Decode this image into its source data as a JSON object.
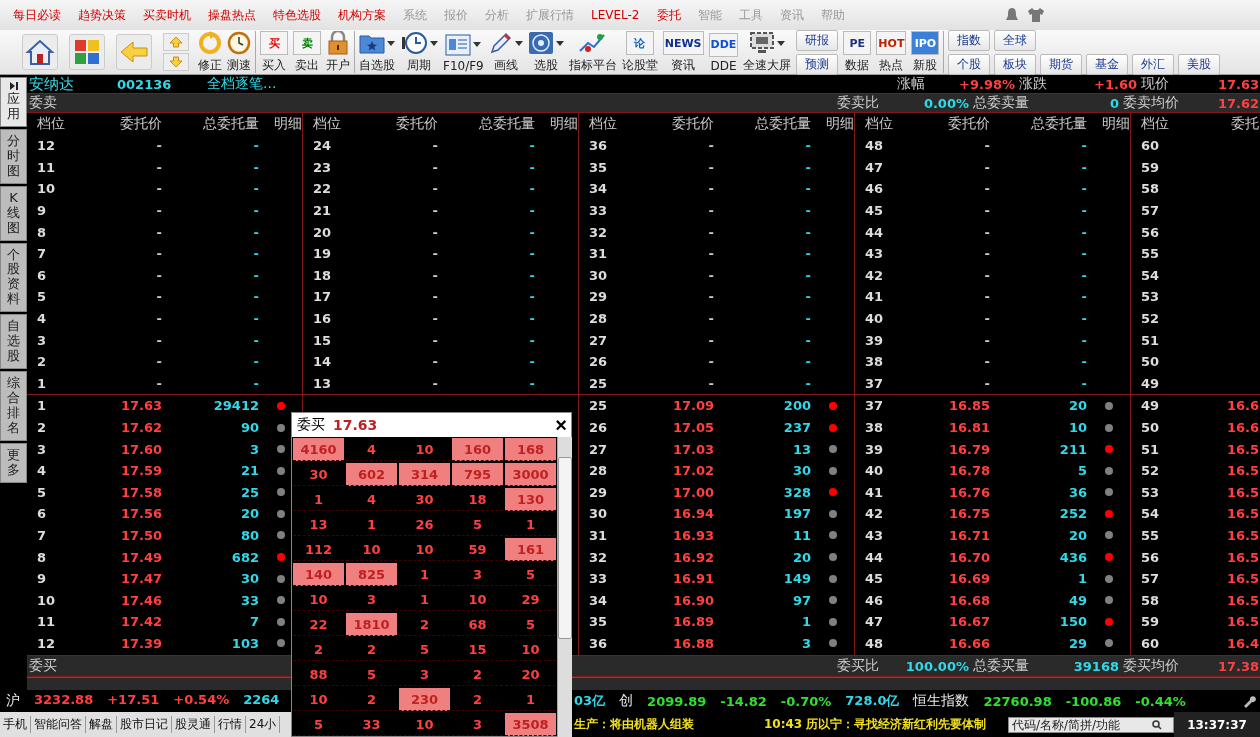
{
  "menu": [
    {
      "label": "每日必读",
      "emphasized": true
    },
    {
      "label": "趋势决策",
      "emphasized": true
    },
    {
      "label": "买卖时机",
      "emphasized": true
    },
    {
      "label": "操盘热点",
      "emphasized": true
    },
    {
      "label": "特色选股",
      "emphasized": true
    },
    {
      "label": "机构方案",
      "emphasized": true
    },
    {
      "label": "系统",
      "emphasized": false
    },
    {
      "label": "报价",
      "emphasized": false
    },
    {
      "label": "分析",
      "emphasized": false
    },
    {
      "label": "扩展行情",
      "emphasized": false
    },
    {
      "label": "LEVEL-2",
      "emphasized": true
    },
    {
      "label": "委托",
      "emphasized": true
    },
    {
      "label": "智能",
      "emphasized": false
    },
    {
      "label": "工具",
      "emphasized": false
    },
    {
      "label": "资讯",
      "emphasized": false
    },
    {
      "label": "帮助",
      "emphasized": false
    }
  ],
  "toolbar": [
    [
      {
        "kind": "big"
      },
      {
        "kind": "big"
      },
      {
        "kind": "big"
      },
      {
        "kind": "updown"
      },
      {
        "kind": "labeled",
        "label": "修正"
      },
      {
        "kind": "labeled",
        "label": "测速"
      }
    ],
    [
      {
        "kind": "labeled",
        "glyph": "买",
        "color": "#e00000",
        "label": "买入"
      },
      {
        "kind": "labeled",
        "glyph": "卖",
        "color": "#008000",
        "label": "卖出"
      },
      {
        "kind": "labeled",
        "label": "开户"
      }
    ],
    [
      {
        "kind": "dropdown",
        "label": "自选股"
      },
      {
        "kind": "dropdown",
        "label": "周期"
      },
      {
        "kind": "dropdown",
        "label": "F10/F9"
      },
      {
        "kind": "dropdown",
        "label": "画线"
      },
      {
        "kind": "dropdown",
        "label": "选股"
      },
      {
        "kind": "labeled",
        "label": "指标平台"
      },
      {
        "kind": "labeled",
        "glyph": "论",
        "color": "#1060c0",
        "label": "论股堂"
      },
      {
        "kind": "labeled",
        "glyph": "NEWS",
        "color": "#103090",
        "label": "资讯"
      },
      {
        "kind": "labeled",
        "glyph": "DDE",
        "color": "#1050d0",
        "label": "DDE"
      },
      {
        "kind": "dropdown",
        "label": "全速大屏"
      },
      {
        "kind": "stack",
        "labels": [
          "研报",
          "预测"
        ]
      },
      {
        "kind": "labeled",
        "glyph": "PE",
        "color": "#203080",
        "label": "数据"
      },
      {
        "kind": "labeled",
        "glyph": "HOT",
        "color": "#c02000",
        "label": "热点"
      },
      {
        "kind": "labeled",
        "glyph": "IPO",
        "label": "新股"
      }
    ],
    [
      {
        "kind": "grid",
        "rows": [
          [
            "指数",
            "全球"
          ],
          [
            "个股",
            "板块",
            "期货",
            "基金",
            "外汇",
            "美股"
          ]
        ]
      }
    ]
  ],
  "side_tabs": [
    {
      "label": "应用",
      "selected": true
    },
    {
      "label": "分时图",
      "selected": false
    },
    {
      "label": "K线图",
      "selected": false
    },
    {
      "label": "个股资料",
      "selected": false
    },
    {
      "label": "自选股",
      "selected": false
    },
    {
      "label": "综合排名",
      "selected": false
    },
    {
      "label": "更多",
      "selected": false
    }
  ],
  "stock": {
    "name": "安纳达",
    "code": "002136",
    "mode": "全档逐笔...",
    "stats": [
      {
        "label": "涨幅",
        "value": "+9.98%"
      },
      {
        "label": "涨跌",
        "value": "+1.60"
      },
      {
        "label": "现价",
        "value": "17.63"
      }
    ]
  },
  "sell_bar": {
    "title": "委卖",
    "stats": [
      {
        "label": "委卖比",
        "value": "0.00%",
        "kind": "amount"
      },
      {
        "label": "总委卖量",
        "value": "0",
        "kind": "amount"
      },
      {
        "label": "委卖均价",
        "value": "17.62",
        "kind": "price"
      }
    ]
  },
  "buy_bar": {
    "title": "委买",
    "stats": [
      {
        "label": "委买比",
        "value": "100.00%",
        "kind": "amount"
      },
      {
        "label": "总委买量",
        "value": "39168",
        "kind": "amount"
      },
      {
        "label": "委买均价",
        "value": "17.38",
        "kind": "price"
      }
    ]
  },
  "groups": [
    {
      "columns": [
        "档位",
        "委托价",
        "总委托量",
        "明细"
      ],
      "sell": [
        [
          "12",
          "-",
          "-"
        ],
        [
          "11",
          "-",
          "-"
        ],
        [
          "10",
          "-",
          "-"
        ],
        [
          "9",
          "-",
          "-"
        ],
        [
          "8",
          "-",
          "-"
        ],
        [
          "7",
          "-",
          "-"
        ],
        [
          "6",
          "-",
          "-"
        ],
        [
          "5",
          "-",
          "-"
        ],
        [
          "4",
          "-",
          "-"
        ],
        [
          "3",
          "-",
          "-"
        ],
        [
          "2",
          "-",
          "-"
        ],
        [
          "1",
          "-",
          "-"
        ]
      ],
      "buy": [
        {
          "level": "1",
          "price": "17.63",
          "volume": "29412",
          "color": "#ff0000"
        },
        {
          "level": "2",
          "price": "17.62",
          "volume": "90",
          "color": "#808080"
        },
        {
          "level": "3",
          "price": "17.60",
          "volume": "3",
          "color": "#808080"
        },
        {
          "level": "4",
          "price": "17.59",
          "volume": "21",
          "color": "#808080"
        },
        {
          "level": "5",
          "price": "17.58",
          "volume": "25",
          "color": "#808080"
        },
        {
          "level": "6",
          "price": "17.56",
          "volume": "20",
          "color": "#808080"
        },
        {
          "level": "7",
          "price": "17.50",
          "volume": "80",
          "color": "#808080"
        },
        {
          "level": "8",
          "price": "17.49",
          "volume": "682",
          "color": "#ff0000"
        },
        {
          "level": "9",
          "price": "17.47",
          "volume": "30",
          "color": "#808080"
        },
        {
          "level": "10",
          "price": "17.46",
          "volume": "33",
          "color": "#808080"
        },
        {
          "level": "11",
          "price": "17.42",
          "volume": "7",
          "color": "#808080"
        },
        {
          "level": "12",
          "price": "17.39",
          "volume": "103",
          "color": "#808080"
        }
      ]
    },
    {
      "columns": [
        "档位",
        "委托价",
        "总委托量",
        "明细"
      ],
      "sell": [
        [
          "24",
          "-",
          "-"
        ],
        [
          "23",
          "-",
          "-"
        ],
        [
          "22",
          "-",
          "-"
        ],
        [
          "21",
          "-",
          "-"
        ],
        [
          "20",
          "-",
          "-"
        ],
        [
          "19",
          "-",
          "-"
        ],
        [
          "18",
          "-",
          "-"
        ],
        [
          "17",
          "-",
          "-"
        ],
        [
          "16",
          "-",
          "-"
        ],
        [
          "15",
          "-",
          "-"
        ],
        [
          "14",
          "-",
          "-"
        ],
        [
          "13",
          "-",
          "-"
        ]
      ]
    },
    {
      "columns": [
        "档位",
        "委托价",
        "总委托量",
        "明细"
      ],
      "sell": [
        [
          "36",
          "-",
          "-"
        ],
        [
          "35",
          "-",
          "-"
        ],
        [
          "34",
          "-",
          "-"
        ],
        [
          "33",
          "-",
          "-"
        ],
        [
          "32",
          "-",
          "-"
        ],
        [
          "31",
          "-",
          "-"
        ],
        [
          "30",
          "-",
          "-"
        ],
        [
          "29",
          "-",
          "-"
        ],
        [
          "28",
          "-",
          "-"
        ],
        [
          "27",
          "-",
          "-"
        ],
        [
          "26",
          "-",
          "-"
        ],
        [
          "25",
          "-",
          "-"
        ]
      ],
      "buy": [
        {
          "level": "25",
          "price": "17.09",
          "volume": "200",
          "color": "#ff0000"
        },
        {
          "level": "26",
          "price": "17.05",
          "volume": "237",
          "color": "#ff0000"
        },
        {
          "level": "27",
          "price": "17.03",
          "volume": "13",
          "color": "#808080"
        },
        {
          "level": "28",
          "price": "17.02",
          "volume": "30",
          "color": "#808080"
        },
        {
          "level": "29",
          "price": "17.00",
          "volume": "328",
          "color": "#ff0000"
        },
        {
          "level": "30",
          "price": "16.94",
          "volume": "197",
          "color": "#808080"
        },
        {
          "level": "31",
          "price": "16.93",
          "volume": "11",
          "color": "#808080"
        },
        {
          "level": "32",
          "price": "16.92",
          "volume": "20",
          "color": "#808080"
        },
        {
          "level": "33",
          "price": "16.91",
          "volume": "149",
          "color": "#808080"
        },
        {
          "level": "34",
          "price": "16.90",
          "volume": "97",
          "color": "#808080"
        },
        {
          "level": "35",
          "price": "16.89",
          "volume": "1",
          "color": "#808080"
        },
        {
          "level": "36",
          "price": "16.88",
          "volume": "3",
          "color": "#808080"
        }
      ]
    },
    {
      "columns": [
        "档位",
        "委托价",
        "总委托量",
        "明细"
      ],
      "sell": [
        [
          "48",
          "-",
          "-"
        ],
        [
          "47",
          "-",
          "-"
        ],
        [
          "46",
          "-",
          "-"
        ],
        [
          "45",
          "-",
          "-"
        ],
        [
          "44",
          "-",
          "-"
        ],
        [
          "43",
          "-",
          "-"
        ],
        [
          "42",
          "-",
          "-"
        ],
        [
          "41",
          "-",
          "-"
        ],
        [
          "40",
          "-",
          "-"
        ],
        [
          "39",
          "-",
          "-"
        ],
        [
          "38",
          "-",
          "-"
        ],
        [
          "37",
          "-",
          "-"
        ]
      ],
      "buy": [
        {
          "level": "37",
          "price": "16.85",
          "volume": "20",
          "color": "#808080"
        },
        {
          "level": "38",
          "price": "16.81",
          "volume": "10",
          "color": "#808080"
        },
        {
          "level": "39",
          "price": "16.79",
          "volume": "211",
          "color": "#ff0000"
        },
        {
          "level": "40",
          "price": "16.78",
          "volume": "5",
          "color": "#808080"
        },
        {
          "level": "41",
          "price": "16.76",
          "volume": "36",
          "color": "#808080"
        },
        {
          "level": "42",
          "price": "16.75",
          "volume": "252",
          "color": "#ff0000"
        },
        {
          "level": "43",
          "price": "16.71",
          "volume": "20",
          "color": "#808080"
        },
        {
          "level": "44",
          "price": "16.70",
          "volume": "436",
          "color": "#ff0000"
        },
        {
          "level": "45",
          "price": "16.69",
          "volume": "1",
          "color": "#808080"
        },
        {
          "level": "46",
          "price": "16.68",
          "volume": "49",
          "color": "#808080"
        },
        {
          "level": "47",
          "price": "16.67",
          "volume": "150",
          "color": "#ff0000"
        },
        {
          "level": "48",
          "price": "16.66",
          "volume": "29",
          "color": "#808080"
        }
      ]
    },
    {
      "columns": [
        "档位",
        "委托"
      ],
      "sell": [
        [
          "60"
        ],
        [
          "59"
        ],
        [
          "58"
        ],
        [
          "57"
        ],
        [
          "56"
        ],
        [
          "55"
        ],
        [
          "54"
        ],
        [
          "53"
        ],
        [
          "52"
        ],
        [
          "51"
        ],
        [
          "50"
        ],
        [
          "49"
        ]
      ],
      "buy": [
        {
          "level": "49",
          "price": "16.6"
        },
        {
          "level": "50",
          "price": "16.6"
        },
        {
          "level": "51",
          "price": "16.5"
        },
        {
          "level": "52",
          "price": "16.5"
        },
        {
          "level": "53",
          "price": "16.5"
        },
        {
          "level": "54",
          "price": "16.5"
        },
        {
          "level": "55",
          "price": "16.5"
        },
        {
          "level": "56",
          "price": "16.5"
        },
        {
          "level": "57",
          "price": "16.5"
        },
        {
          "level": "58",
          "price": "16.5"
        },
        {
          "level": "59",
          "price": "16.5"
        },
        {
          "level": "60",
          "price": "16.4"
        }
      ]
    }
  ],
  "popup": {
    "title": "委买",
    "price": "17.63",
    "close": "×",
    "cells": [
      [
        {
          "v": "4160",
          "highlighted": true
        },
        {
          "v": "4",
          "highlighted": false
        },
        {
          "v": "10",
          "highlighted": false
        },
        {
          "v": "160",
          "highlighted": true
        },
        {
          "v": "168",
          "highlighted": true
        }
      ],
      [
        {
          "v": "30",
          "highlighted": false
        },
        {
          "v": "602",
          "highlighted": true
        },
        {
          "v": "314",
          "highlighted": true
        },
        {
          "v": "795",
          "highlighted": true
        },
        {
          "v": "3000",
          "highlighted": true
        }
      ],
      [
        {
          "v": "1",
          "highlighted": false
        },
        {
          "v": "4",
          "highlighted": false
        },
        {
          "v": "30",
          "highlighted": false
        },
        {
          "v": "18",
          "highlighted": false
        },
        {
          "v": "130",
          "highlighted": true
        }
      ],
      [
        {
          "v": "13",
          "highlighted": false
        },
        {
          "v": "1",
          "highlighted": false
        },
        {
          "v": "26",
          "highlighted": false
        },
        {
          "v": "5",
          "highlighted": false
        },
        {
          "v": "1",
          "highlighted": false
        }
      ],
      [
        {
          "v": "112",
          "highlighted": false
        },
        {
          "v": "10",
          "highlighted": false
        },
        {
          "v": "10",
          "highlighted": false
        },
        {
          "v": "59",
          "highlighted": false
        },
        {
          "v": "161",
          "highlighted": true
        }
      ],
      [
        {
          "v": "140",
          "highlighted": true
        },
        {
          "v": "825",
          "highlighted": true
        },
        {
          "v": "1",
          "highlighted": false
        },
        {
          "v": "3",
          "highlighted": false
        },
        {
          "v": "5",
          "highlighted": false
        }
      ],
      [
        {
          "v": "10",
          "highlighted": false
        },
        {
          "v": "3",
          "highlighted": false
        },
        {
          "v": "1",
          "highlighted": false
        },
        {
          "v": "10",
          "highlighted": false
        },
        {
          "v": "29",
          "highlighted": false
        }
      ],
      [
        {
          "v": "22",
          "highlighted": false
        },
        {
          "v": "1810",
          "highlighted": true
        },
        {
          "v": "2",
          "highlighted": false
        },
        {
          "v": "68",
          "highlighted": false
        },
        {
          "v": "5",
          "highlighted": false
        }
      ],
      [
        {
          "v": "2",
          "highlighted": false
        },
        {
          "v": "2",
          "highlighted": false
        },
        {
          "v": "5",
          "highlighted": false
        },
        {
          "v": "15",
          "highlighted": false
        },
        {
          "v": "10",
          "highlighted": false
        }
      ],
      [
        {
          "v": "88",
          "highlighted": false
        },
        {
          "v": "5",
          "highlighted": false
        },
        {
          "v": "3",
          "highlighted": false
        },
        {
          "v": "2",
          "highlighted": false
        },
        {
          "v": "20",
          "highlighted": false
        }
      ],
      [
        {
          "v": "10",
          "highlighted": false
        },
        {
          "v": "2",
          "highlighted": false
        },
        {
          "v": "230",
          "highlighted": true
        },
        {
          "v": "2",
          "highlighted": false
        },
        {
          "v": "1",
          "highlighted": false
        }
      ],
      [
        {
          "v": "5",
          "highlighted": false
        },
        {
          "v": "33",
          "highlighted": false
        },
        {
          "v": "10",
          "highlighted": false
        },
        {
          "v": "3",
          "highlighted": false
        },
        {
          "v": "3508",
          "highlighted": true
        }
      ]
    ]
  },
  "index_bar": {
    "left": [
      {
        "text": "沪",
        "kind": "label"
      },
      {
        "text": "3232.88",
        "kind": "up"
      },
      {
        "text": "+17.51",
        "kind": "up"
      },
      {
        "text": "+0.54%",
        "kind": "up"
      },
      {
        "text": "2264",
        "kind": "amount"
      }
    ],
    "right": [
      {
        "text": "03亿",
        "kind": "amount"
      },
      {
        "text": "创",
        "kind": "label"
      },
      {
        "text": "2099.89",
        "kind": "down"
      },
      {
        "text": "-14.82",
        "kind": "down"
      },
      {
        "text": "-0.70%",
        "kind": "down"
      },
      {
        "text": "728.0亿",
        "kind": "amount"
      },
      {
        "text": "恒生指数",
        "kind": "label"
      },
      {
        "text": "22760.98",
        "kind": "down"
      },
      {
        "text": "-100.86",
        "kind": "down"
      },
      {
        "text": "-0.44%",
        "kind": "down"
      }
    ]
  },
  "ticker_bar": {
    "tabs": [
      "手机",
      "智能问答",
      "解盘",
      "股市日记",
      "股灵通",
      "行情",
      "24小"
    ],
    "news": [
      "生产：将由机器人组装",
      "10:43 历以宁：寻找经济新红利先要体制"
    ],
    "search": {
      "placeholder": "代码/名称/简拼/功能"
    },
    "time": "13:37:37"
  }
}
